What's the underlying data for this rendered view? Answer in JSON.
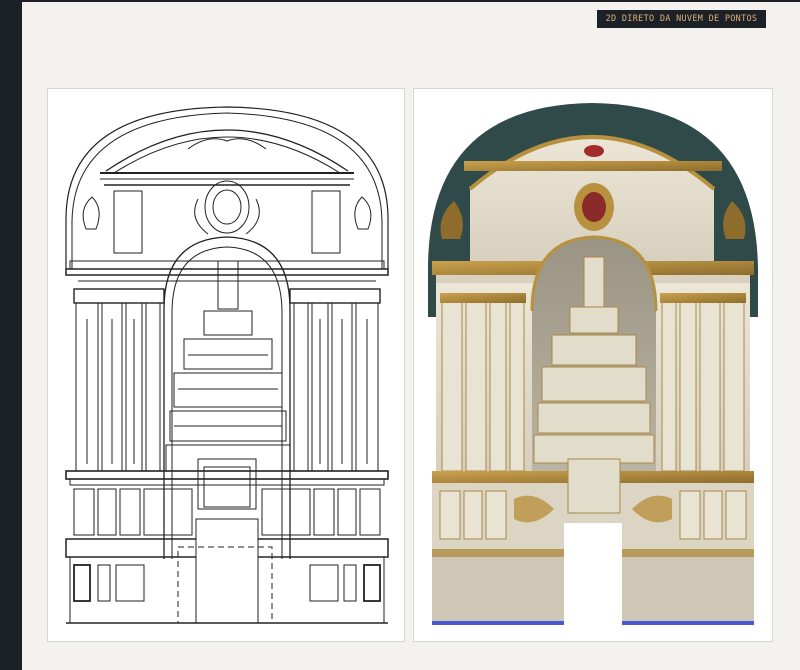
{
  "app": {
    "badge_label": "2D DIRETO DA NUVEM DE PONTOS"
  },
  "colors": {
    "sidebar": "#1c2127",
    "background": "#f4f2ee",
    "badge_text": "#d9b07a",
    "line_drawing": "#222222",
    "stone": "#e8e2d4",
    "gilding": "#b8913f",
    "shadow": "#2f4a48"
  },
  "panels": {
    "left": {
      "content": "altarpiece-line-drawing"
    },
    "right": {
      "content": "altarpiece-point-cloud-render"
    }
  }
}
